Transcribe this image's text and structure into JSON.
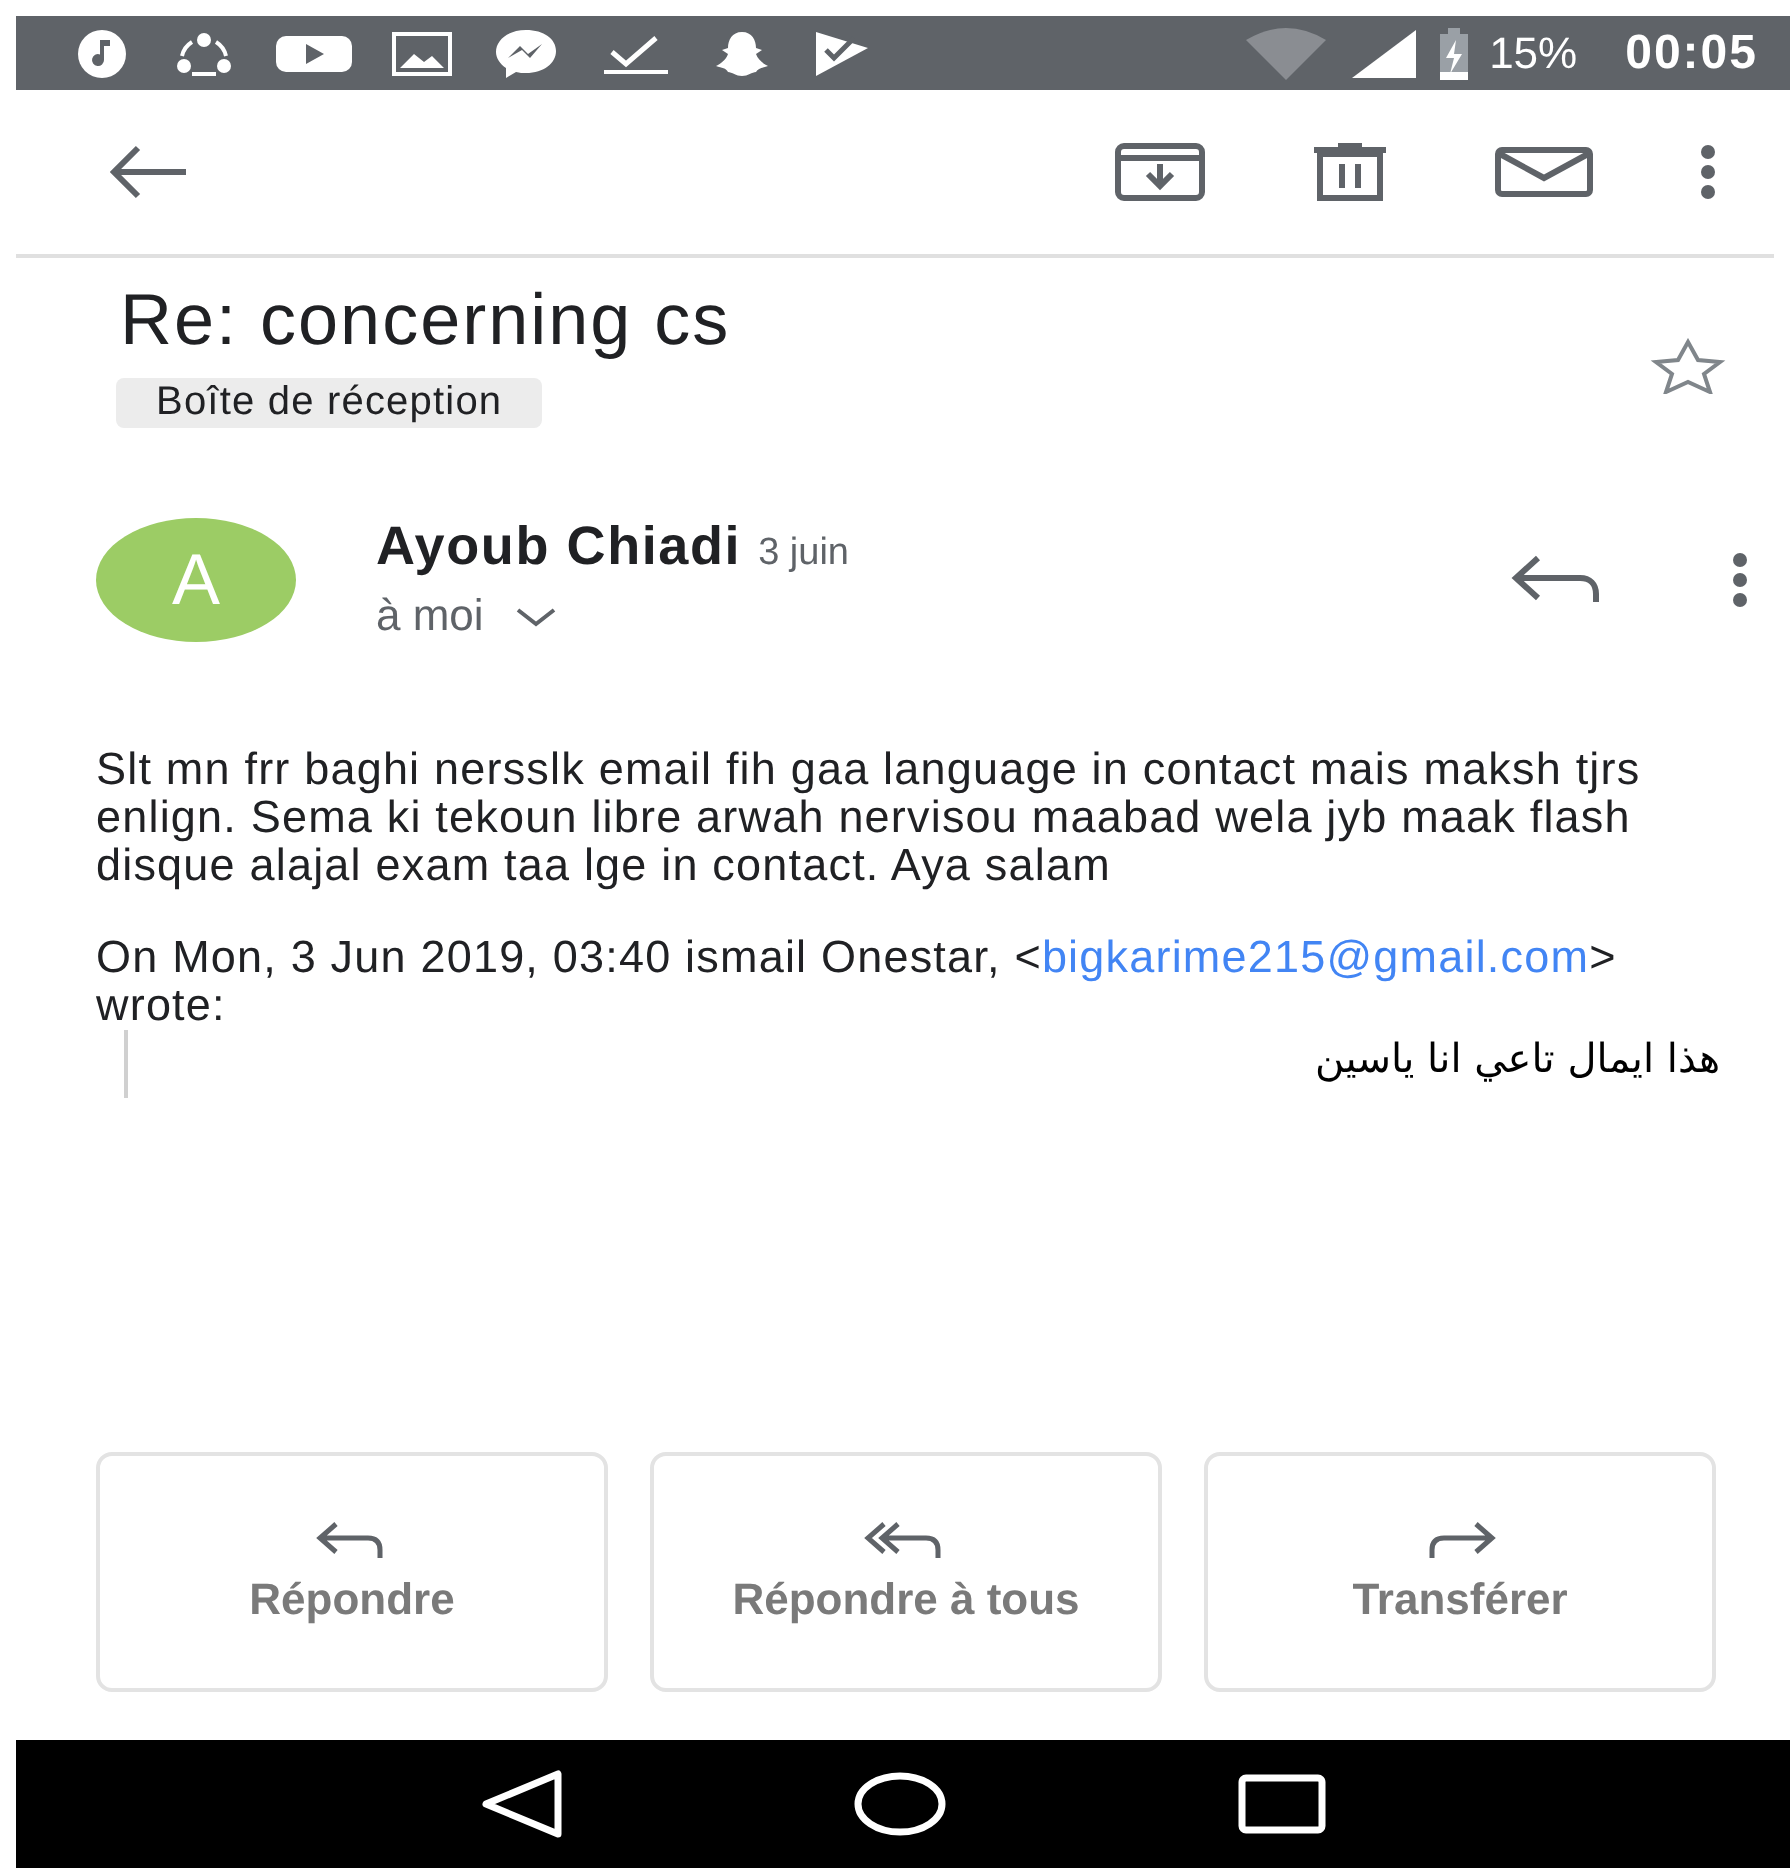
{
  "status_bar": {
    "battery": "15%",
    "time": "00:05"
  },
  "subject": "Re: concerning cs",
  "starred": false,
  "label": "Boîte de réception",
  "message": {
    "avatar": "A",
    "sender": "Ayoub Chiadi",
    "date": "3 juin",
    "recipient": "à moi",
    "body": "Slt mn frr baghi nersslk email fih gaa language in contact mais maksh tjrs  enlign. Sema ki tekoun libre arwah nervisou maabad wela jyb maak flash disque alajal exam taa lge in contact. Aya salam",
    "quote_header": {
      "before": "On Mon, 3 Jun 2019, 03:40 ismail Onestar, <",
      "link": "bigkarime215@gmail.com",
      "after": "> wrote:"
    },
    "quoted": "هذا ايمال تاعي انا ياسين"
  },
  "actions": [
    {
      "kind": "reply",
      "label": "Répondre"
    },
    {
      "kind": "reply_all",
      "label": "Répondre à tous"
    },
    {
      "kind": "forward",
      "label": "Transférer"
    }
  ]
}
